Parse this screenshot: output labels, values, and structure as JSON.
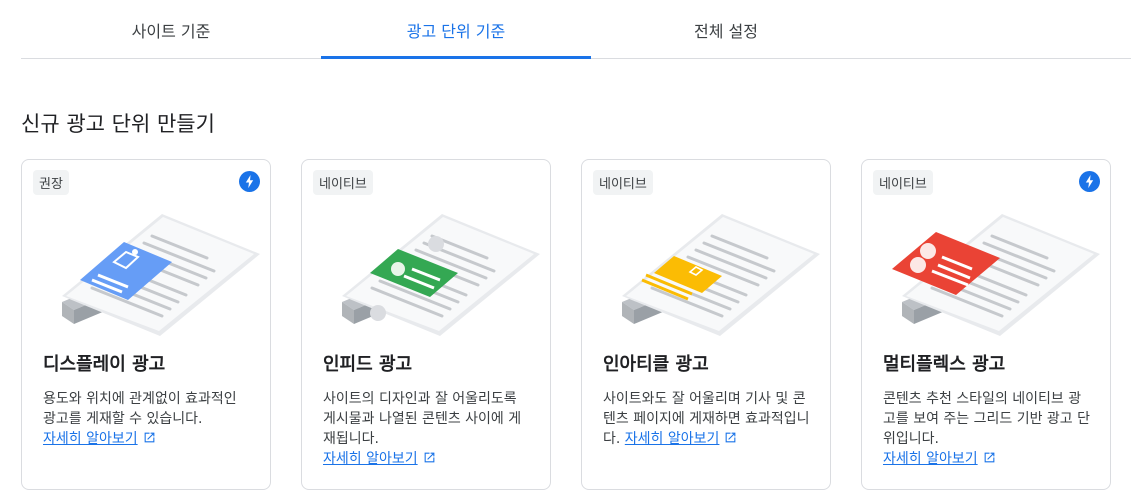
{
  "tabs": [
    {
      "label": "사이트 기준",
      "active": false
    },
    {
      "label": "광고 단위 기준",
      "active": true
    },
    {
      "label": "전체 설정",
      "active": false
    }
  ],
  "section_title": "신규 광고 단위 만들기",
  "learn_more_label": "자세히 알아보기",
  "colors": {
    "accent": "#1a73e8",
    "display": "#669df6",
    "infeed": "#34a853",
    "inarticle": "#fbbc04",
    "multiplex": "#ea4335"
  },
  "cards": [
    {
      "tag": "권장",
      "icon": "lightning-bolt-icon",
      "title": "디스플레이 광고",
      "description": "용도와 위치에 관계없이 효과적인 광고를 게재할 수 있습니다."
    },
    {
      "tag": "네이티브",
      "title": "인피드 광고",
      "description": "사이트의 디자인과 잘 어울리도록 게시물과 나열된 콘텐츠 사이에 게재됩니다."
    },
    {
      "tag": "네이티브",
      "title": "인아티클 광고",
      "description": "사이트와도 잘 어울리며 기사 및 콘텐츠 페이지에 게재하면 효과적입니다."
    },
    {
      "tag": "네이티브",
      "icon": "lightning-bolt-icon",
      "title": "멀티플렉스 광고",
      "description": "콘텐츠 추천 스타일의 네이티브 광고를 보여 주는 그리드 기반 광고 단위입니다."
    }
  ]
}
